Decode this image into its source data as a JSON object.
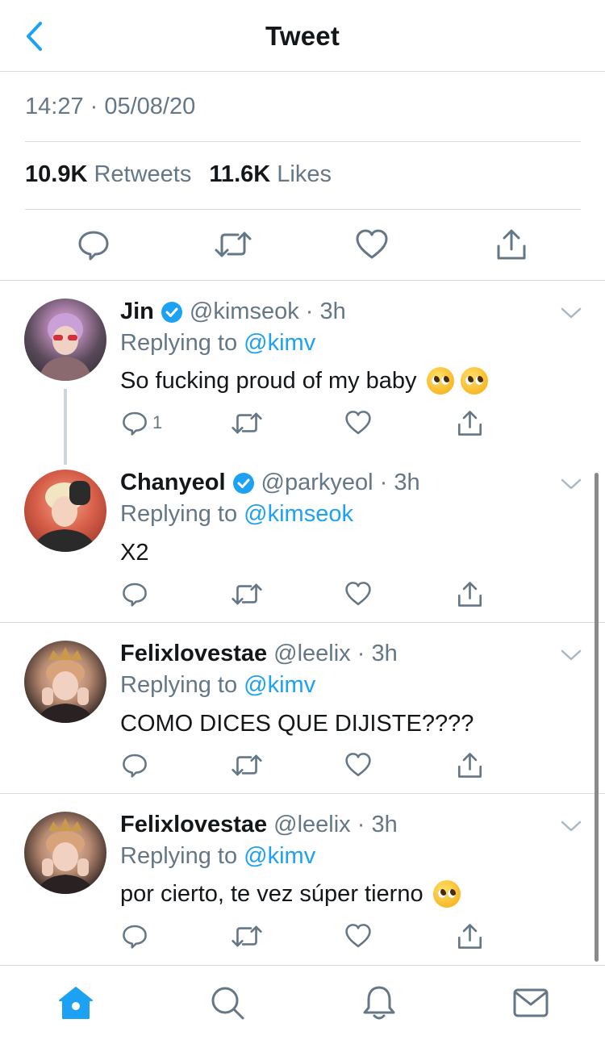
{
  "header": {
    "title": "Tweet",
    "back_icon": "chevron-left-icon"
  },
  "tweet": {
    "timestamp": "14:27 · 05/08/20",
    "retweets_count": "10.9K",
    "retweets_label": "Retweets",
    "likes_count": "11.6K",
    "likes_label": "Likes"
  },
  "colors": {
    "accent": "#1da1f2",
    "secondary_text": "#657786",
    "divider": "#d5dade"
  },
  "replies": [
    {
      "name": "Jin",
      "verified": true,
      "handle": "@kimseok · 3h",
      "replying_prefix": "Replying to",
      "mention": "@kimv",
      "text": "So fucking proud of my baby",
      "emoji": [
        "pleading-face-emoji",
        "pleading-face-emoji"
      ],
      "reply_count": "1"
    },
    {
      "name": "Chanyeol",
      "verified": true,
      "handle": "@parkyeol · 3h",
      "replying_prefix": "Replying to",
      "mention": "@kimseok",
      "text": "X2"
    },
    {
      "name": "Felixlovestae",
      "verified": false,
      "handle": "@leelix · 3h",
      "replying_prefix": "Replying to",
      "mention": "@kimv",
      "text": "COMO DICES QUE DIJISTE????"
    },
    {
      "name": "Felixlovestae",
      "verified": false,
      "handle": "@leelix · 3h",
      "replying_prefix": "Replying to",
      "mention": "@kimv",
      "text": "por cierto, te vez súper tierno",
      "emoji": [
        "pleading-face-emoji"
      ]
    }
  ],
  "tabbar": {
    "items": [
      "home-icon",
      "search-icon",
      "bell-icon",
      "mail-icon"
    ],
    "active": "home-icon"
  }
}
